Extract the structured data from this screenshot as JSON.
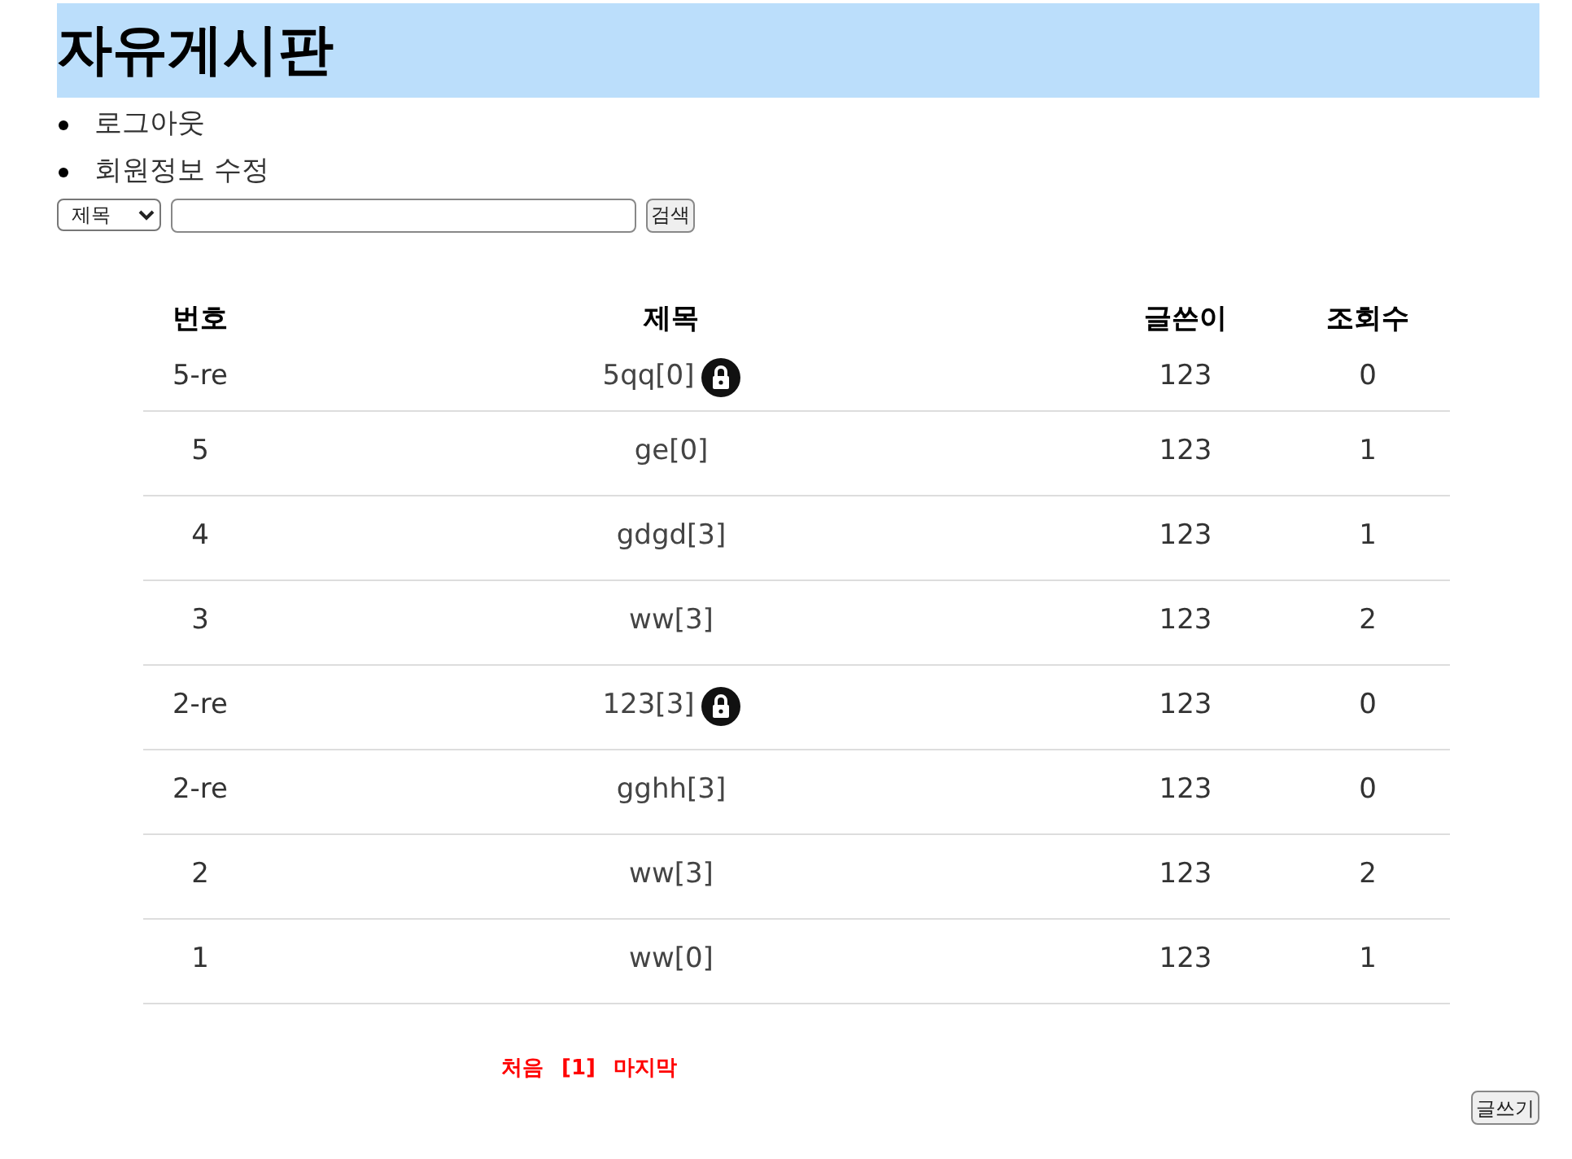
{
  "header": {
    "title": "자유게시판"
  },
  "menu": [
    {
      "label": "로그아웃"
    },
    {
      "label": "회원정보 수정"
    }
  ],
  "search": {
    "select": "제목",
    "button": "검색"
  },
  "table": {
    "columns": [
      "번호",
      "제목",
      "글쓴이",
      "조회수"
    ],
    "rows": [
      {
        "number": "5-re",
        "title": "5qq[0]",
        "locked": true,
        "author": "123",
        "views": "0"
      },
      {
        "number": "5",
        "title": "ge[0]",
        "locked": false,
        "author": "123",
        "views": "1"
      },
      {
        "number": "4",
        "title": "gdgd[3]",
        "locked": false,
        "author": "123",
        "views": "1"
      },
      {
        "number": "3",
        "title": "ww[3]",
        "locked": false,
        "author": "123",
        "views": "2"
      },
      {
        "number": "2-re",
        "title": "123[3]",
        "locked": true,
        "author": "123",
        "views": "0"
      },
      {
        "number": "2-re",
        "title": "gghh[3]",
        "locked": false,
        "author": "123",
        "views": "0"
      },
      {
        "number": "2",
        "title": "ww[3]",
        "locked": false,
        "author": "123",
        "views": "2"
      },
      {
        "number": "1",
        "title": "ww[0]",
        "locked": false,
        "author": "123",
        "views": "1"
      }
    ]
  },
  "pagination": {
    "first": "처음",
    "pages": [
      "[1]"
    ],
    "last": "마지막"
  },
  "write_button": "글쓰기"
}
